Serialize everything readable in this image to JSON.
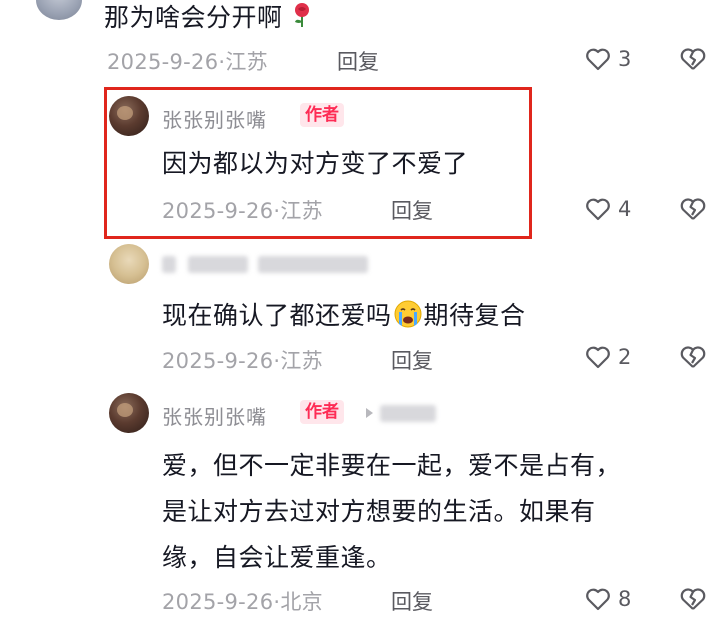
{
  "comments": [
    {
      "text": "那为啥会分开啊",
      "date": "2025-9-26·江苏",
      "reply": "回复",
      "likes": "3"
    },
    {
      "username": "张张别张嘴",
      "badge": "作者",
      "text": "因为都以为对方变了不爱了",
      "date": "2025-9-26·江苏",
      "reply": "回复",
      "likes": "4"
    },
    {
      "text_before_emoji": "现在确认了都还爱吗",
      "text_after_emoji": "期待复合",
      "emoji": "crying-face-emoji",
      "date": "2025-9-26·江苏",
      "reply": "回复",
      "likes": "2"
    },
    {
      "username": "张张别张嘴",
      "badge": "作者",
      "text_lines": [
        "爱，但不一定非要在一起，爱不是占有，",
        "是让对方去过对方想要的生活。如果有",
        "缘，自会让爱重逢。"
      ],
      "date": "2025-9-26·北京",
      "reply": "回复",
      "likes": "8"
    }
  ],
  "colors": {
    "highlight_box": "#e0261c",
    "author_badge_text": "#fe2c55",
    "author_badge_bg": "#ffe6eb",
    "meta_text": "#a3a3a8"
  }
}
